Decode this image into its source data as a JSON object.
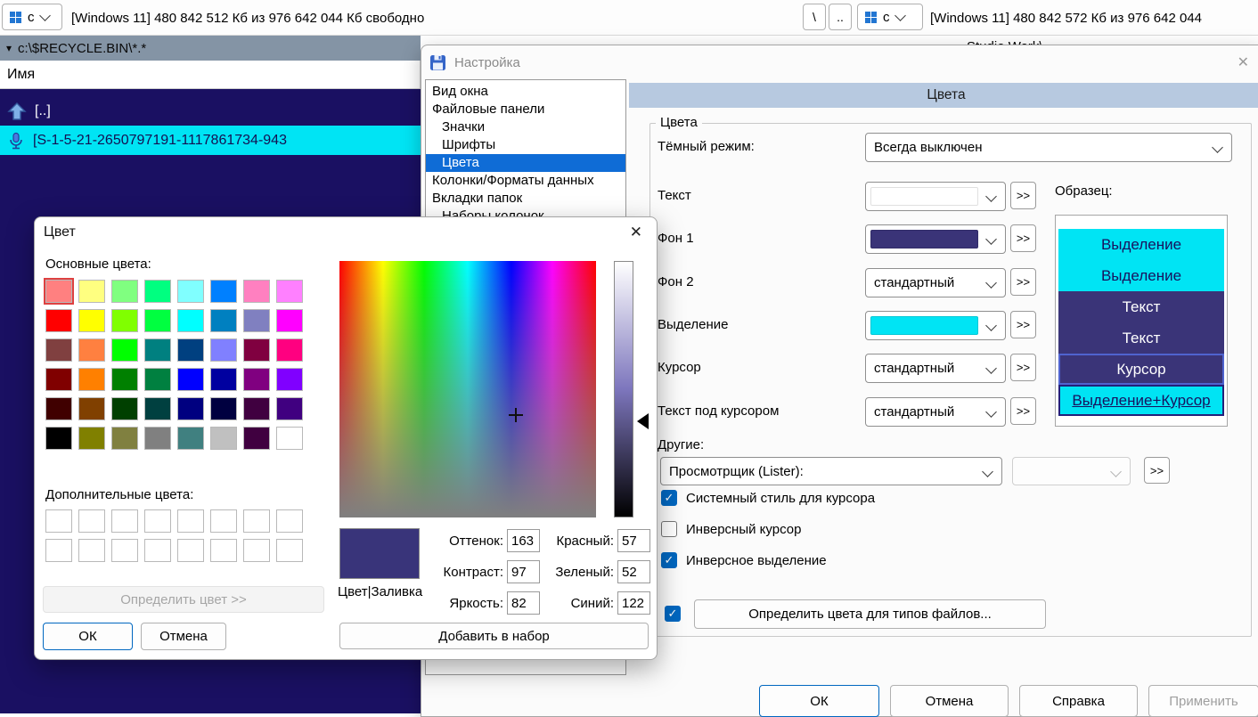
{
  "icons": {
    "drive": "windows-grid",
    "path_dropdown": "▾",
    "check": "✓",
    "up_item": "arrow-up",
    "selected_item": "microphone",
    "settings_dialog": "floppy-disk",
    "close": "✕",
    "lum_slider": "left-triangle"
  },
  "window": {
    "toolbar": {
      "left_drive": "c",
      "left_free": "[Windows 11]  480 842 512 Кб из 976 642 044 Кб свободно",
      "backslash": "\\",
      "parent": "..",
      "right_drive": "c",
      "right_free": "[Windows 11]  480 842 572 Кб из 976 642 044"
    },
    "left_panel": {
      "path": "c:\\$RECYCLE.BIN\\*.*",
      "name_header": "Имя",
      "up_item": "[..]",
      "selected_item": "[S-1-5-21-2650797191-1117861734-943",
      "bg": "#1a1062",
      "selection_bg": "#00e4f4"
    },
    "right_panel": {
      "path_fragment": "Studio Work\\"
    }
  },
  "settings": {
    "title": "Настройка",
    "close": "✕",
    "nav": [
      {
        "label": "Вид окна",
        "indent": 0,
        "selected": false
      },
      {
        "label": "Файловые панели",
        "indent": 0,
        "selected": false
      },
      {
        "label": "Значки",
        "indent": 1,
        "selected": false
      },
      {
        "label": "Шрифты",
        "indent": 1,
        "selected": false
      },
      {
        "label": "Цвета",
        "indent": 1,
        "selected": true
      },
      {
        "label": "Колонки/Форматы данных",
        "indent": 0,
        "selected": false
      },
      {
        "label": "Вкладки папок",
        "indent": 0,
        "selected": false
      },
      {
        "label": "Наборы колонок",
        "indent": 1,
        "selected": false
      }
    ],
    "page_header": "Цвета",
    "group_title": "Цвета",
    "dark_mode_label": "Тёмный режим:",
    "dark_mode_value": "Всегда выключен",
    "rows": [
      {
        "label": "Текст",
        "swatch": "#ffffff"
      },
      {
        "label": "Фон 1",
        "swatch": "#3a3478"
      },
      {
        "label": "Фон 2",
        "value": "стандартный"
      },
      {
        "label": "Выделение",
        "swatch": "#00e4f4"
      },
      {
        "label": "Курсор",
        "value": "стандартный"
      },
      {
        "label": "Текст под курсором",
        "value": "стандартный"
      }
    ],
    "more": ">>",
    "sample_label": "Образец:",
    "sample": [
      {
        "text": "Выделение",
        "style": "sel"
      },
      {
        "text": "Выделение",
        "style": "sel"
      },
      {
        "text": "Текст",
        "style": "txt"
      },
      {
        "text": "Текст",
        "style": "txt"
      },
      {
        "text": "Курсор",
        "style": "cur"
      },
      {
        "text": "Выделение+Курсор",
        "style": "selcur"
      }
    ],
    "others_label": "Другие:",
    "others_value": "Просмотрщик (Lister):",
    "checks": [
      {
        "label": "Системный стиль для курсора",
        "checked": true
      },
      {
        "label": "Инверсный курсор",
        "checked": false
      },
      {
        "label": "Инверсное выделение",
        "checked": true
      }
    ],
    "filetypes_checked": true,
    "filetypes_button": "Определить цвета для типов файлов...",
    "ok": "ОК",
    "cancel": "Отмена",
    "help": "Справка",
    "apply": "Применить"
  },
  "color_dialog": {
    "title": "Цвет",
    "close": "✕",
    "basic_label": "Основные цвета:",
    "custom_label": "Дополнительные цвета:",
    "basic_colors": [
      "#FF8080",
      "#FFFF80",
      "#80FF80",
      "#00FF80",
      "#80FFFF",
      "#0080FF",
      "#FF80C0",
      "#FF80FF",
      "#FF0000",
      "#FFFF00",
      "#80FF00",
      "#00FF40",
      "#00FFFF",
      "#0080C0",
      "#8080C0",
      "#FF00FF",
      "#804040",
      "#FF8040",
      "#00FF00",
      "#008080",
      "#004080",
      "#8080FF",
      "#800040",
      "#FF0080",
      "#800000",
      "#FF8000",
      "#008000",
      "#008040",
      "#0000FF",
      "#0000A0",
      "#800080",
      "#8000FF",
      "#400000",
      "#804000",
      "#004000",
      "#004040",
      "#000080",
      "#000040",
      "#400040",
      "#400080",
      "#000000",
      "#808000",
      "#808040",
      "#808080",
      "#408080",
      "#C0C0C0",
      "#400040",
      "#FFFFFF"
    ],
    "custom_colors": [
      "#FFFFFF",
      "#FFFFFF",
      "#FFFFFF",
      "#FFFFFF",
      "#FFFFFF",
      "#FFFFFF",
      "#FFFFFF",
      "#FFFFFF",
      "#FFFFFF",
      "#FFFFFF",
      "#FFFFFF",
      "#FFFFFF",
      "#FFFFFF",
      "#FFFFFF",
      "#FFFFFF",
      "#FFFFFF"
    ],
    "define_button": "Определить цвет >>",
    "ok": "ОК",
    "cancel": "Отмена",
    "current_color": "#39347a",
    "current_label": "Цвет|Заливка",
    "hue_label": "Оттенок:",
    "hue": "163",
    "contrast_label": "Контраст:",
    "contrast": "97",
    "bright_label": "Яркость:",
    "bright": "82",
    "red_label": "Красный:",
    "red": "57",
    "green_label": "Зеленый:",
    "green": "52",
    "blue_label": "Синий:",
    "blue": "122",
    "add_button": "Добавить в набор"
  }
}
